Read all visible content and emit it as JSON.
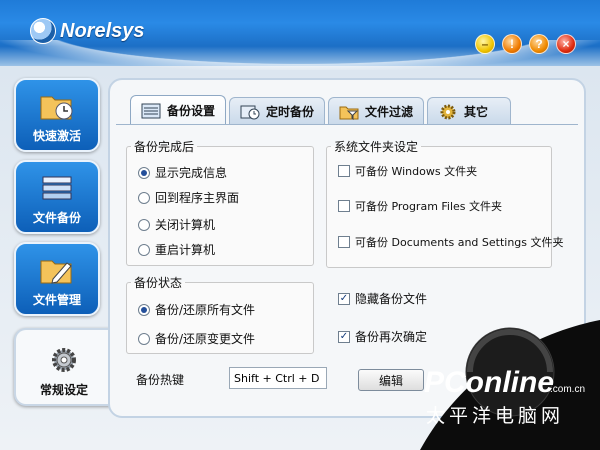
{
  "app": {
    "name": "Norelsys"
  },
  "window_buttons": [
    {
      "icon": "minimize-icon",
      "glyph": "–"
    },
    {
      "icon": "alert-icon",
      "glyph": "!"
    },
    {
      "icon": "help-icon",
      "glyph": "?"
    },
    {
      "icon": "close-icon",
      "glyph": "×"
    }
  ],
  "sidebar": {
    "items": [
      {
        "label": "快速激活",
        "icon": "folder-clock-icon"
      },
      {
        "label": "文件备份",
        "icon": "stack-icon"
      },
      {
        "label": "文件管理",
        "icon": "folder-pen-icon"
      },
      {
        "label": "常规设定",
        "icon": "gear-icon"
      }
    ]
  },
  "tabs": [
    {
      "label": "备份设置",
      "icon": "list-icon"
    },
    {
      "label": "定时备份",
      "icon": "clock-icon"
    },
    {
      "label": "文件过滤",
      "icon": "folder-filter-icon"
    },
    {
      "label": "其它",
      "icon": "gear-icon"
    }
  ],
  "after_backup": {
    "title": "备份完成后",
    "options": [
      "显示完成信息",
      "回到程序主界面",
      "关闭计算机",
      "重启计算机"
    ],
    "selected": 0
  },
  "system_folders": {
    "title": "系统文件夹设定",
    "options": [
      "可备份 Windows 文件夹",
      "可备份 Program Files 文件夹",
      "可备份 Documents and Settings 文件夹"
    ],
    "checked": [
      false,
      false,
      false
    ]
  },
  "backup_state": {
    "title": "备份状态",
    "options": [
      "备份/还原所有文件",
      "备份/还原变更文件"
    ],
    "selected": 0
  },
  "extra_options": {
    "options": [
      "隐藏备份文件",
      "备份再次确定"
    ],
    "checked": [
      true,
      true
    ]
  },
  "hotkey": {
    "label": "备份热键",
    "value": "Shift + Ctrl + D",
    "edit_label": "编辑"
  },
  "watermark": {
    "brand": "PConline",
    "domain": ".com.cn",
    "chinese": "太平洋电脑网"
  },
  "colors": {
    "title_blue": "#1f7bd8",
    "nav_blue": "#0d5fb8",
    "panel_bg": "#f5f7f9"
  }
}
